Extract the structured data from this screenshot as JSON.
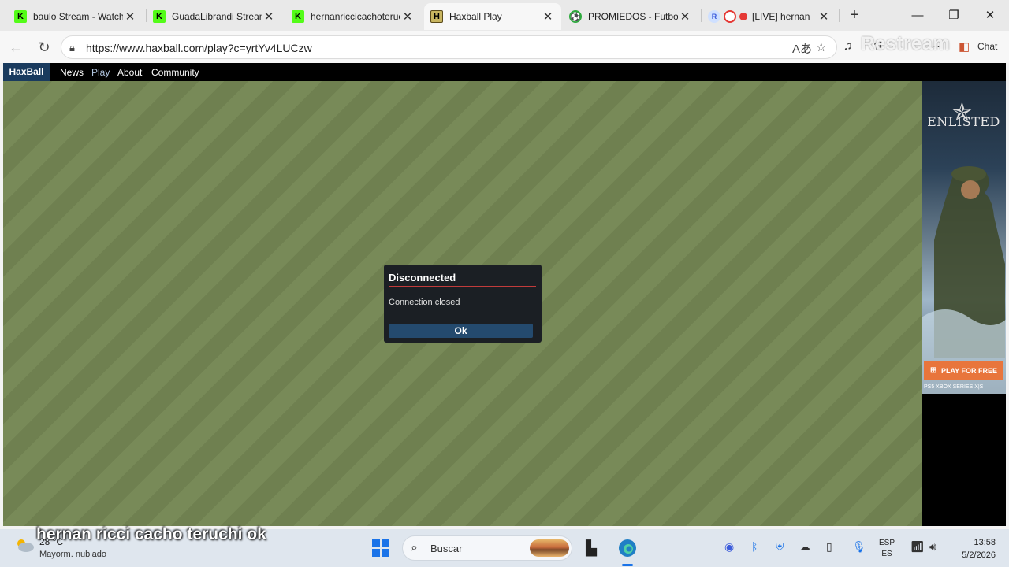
{
  "browser": {
    "tabs": [
      {
        "title": "baulo Stream - Watch",
        "favicon_color": "#53fc18",
        "active": false
      },
      {
        "title": "GuadaLibrandi Stream",
        "favicon_color": "#53fc18",
        "active": false
      },
      {
        "title": "hernanriccicachoteruc",
        "favicon_color": "#53fc18",
        "active": false
      },
      {
        "title": "Haxball Play",
        "favicon_color": "#c8b560",
        "active": true
      },
      {
        "title": "PROMIEDOS - Futbol",
        "favicon_color": "#2eaa3e",
        "active": false
      },
      {
        "title": "[LIVE] hernan",
        "favicon_color": "#e53935",
        "active": false
      }
    ],
    "url": "https://www.haxball.com/play?c=yrtYv4LUCzw",
    "chat_label": "Chat",
    "overlay_watermark": "Restream"
  },
  "site": {
    "nav": {
      "brand": "HaxBall",
      "links": [
        "News",
        "Play",
        "About",
        "Community"
      ],
      "current": "Play"
    },
    "dialog": {
      "title": "Disconnected",
      "message": "Connection closed",
      "button": "Ok"
    },
    "ad": {
      "logo": "ENLISTED",
      "cta": "PLAY FOR FREE",
      "platforms": "PS5   XBOX SERIES X|S"
    },
    "colors": {
      "field": "#788a58",
      "dialog_bg": "#1b1f24",
      "dialog_accent": "#c23b3b",
      "button_bg": "#244a6e"
    }
  },
  "taskbar": {
    "weather": {
      "temp": "28 °C",
      "condition": "Mayorm. nublado"
    },
    "search_placeholder": "Buscar",
    "language": [
      "ESP",
      "ES"
    ],
    "time": "13:58",
    "date": "5/2/2026"
  },
  "stream_caption": "hernan ricci cacho teruchi ok"
}
